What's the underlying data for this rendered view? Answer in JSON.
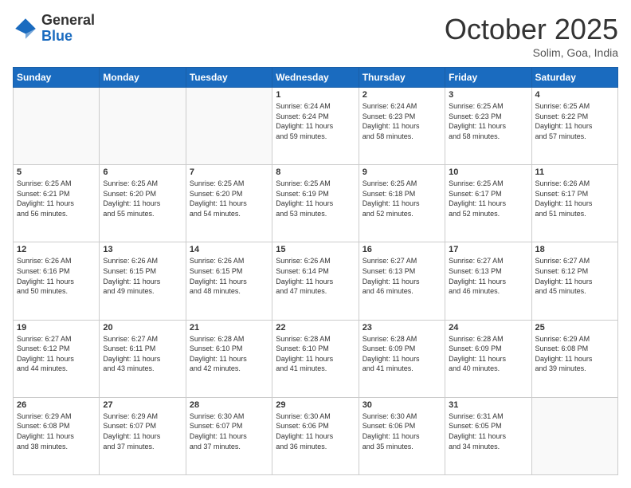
{
  "logo": {
    "general": "General",
    "blue": "Blue"
  },
  "header": {
    "month": "October 2025",
    "location": "Solim, Goa, India"
  },
  "days_of_week": [
    "Sunday",
    "Monday",
    "Tuesday",
    "Wednesday",
    "Thursday",
    "Friday",
    "Saturday"
  ],
  "weeks": [
    [
      {
        "day": "",
        "info": ""
      },
      {
        "day": "",
        "info": ""
      },
      {
        "day": "",
        "info": ""
      },
      {
        "day": "1",
        "info": "Sunrise: 6:24 AM\nSunset: 6:24 PM\nDaylight: 11 hours\nand 59 minutes."
      },
      {
        "day": "2",
        "info": "Sunrise: 6:24 AM\nSunset: 6:23 PM\nDaylight: 11 hours\nand 58 minutes."
      },
      {
        "day": "3",
        "info": "Sunrise: 6:25 AM\nSunset: 6:23 PM\nDaylight: 11 hours\nand 58 minutes."
      },
      {
        "day": "4",
        "info": "Sunrise: 6:25 AM\nSunset: 6:22 PM\nDaylight: 11 hours\nand 57 minutes."
      }
    ],
    [
      {
        "day": "5",
        "info": "Sunrise: 6:25 AM\nSunset: 6:21 PM\nDaylight: 11 hours\nand 56 minutes."
      },
      {
        "day": "6",
        "info": "Sunrise: 6:25 AM\nSunset: 6:20 PM\nDaylight: 11 hours\nand 55 minutes."
      },
      {
        "day": "7",
        "info": "Sunrise: 6:25 AM\nSunset: 6:20 PM\nDaylight: 11 hours\nand 54 minutes."
      },
      {
        "day": "8",
        "info": "Sunrise: 6:25 AM\nSunset: 6:19 PM\nDaylight: 11 hours\nand 53 minutes."
      },
      {
        "day": "9",
        "info": "Sunrise: 6:25 AM\nSunset: 6:18 PM\nDaylight: 11 hours\nand 52 minutes."
      },
      {
        "day": "10",
        "info": "Sunrise: 6:25 AM\nSunset: 6:17 PM\nDaylight: 11 hours\nand 52 minutes."
      },
      {
        "day": "11",
        "info": "Sunrise: 6:26 AM\nSunset: 6:17 PM\nDaylight: 11 hours\nand 51 minutes."
      }
    ],
    [
      {
        "day": "12",
        "info": "Sunrise: 6:26 AM\nSunset: 6:16 PM\nDaylight: 11 hours\nand 50 minutes."
      },
      {
        "day": "13",
        "info": "Sunrise: 6:26 AM\nSunset: 6:15 PM\nDaylight: 11 hours\nand 49 minutes."
      },
      {
        "day": "14",
        "info": "Sunrise: 6:26 AM\nSunset: 6:15 PM\nDaylight: 11 hours\nand 48 minutes."
      },
      {
        "day": "15",
        "info": "Sunrise: 6:26 AM\nSunset: 6:14 PM\nDaylight: 11 hours\nand 47 minutes."
      },
      {
        "day": "16",
        "info": "Sunrise: 6:27 AM\nSunset: 6:13 PM\nDaylight: 11 hours\nand 46 minutes."
      },
      {
        "day": "17",
        "info": "Sunrise: 6:27 AM\nSunset: 6:13 PM\nDaylight: 11 hours\nand 46 minutes."
      },
      {
        "day": "18",
        "info": "Sunrise: 6:27 AM\nSunset: 6:12 PM\nDaylight: 11 hours\nand 45 minutes."
      }
    ],
    [
      {
        "day": "19",
        "info": "Sunrise: 6:27 AM\nSunset: 6:12 PM\nDaylight: 11 hours\nand 44 minutes."
      },
      {
        "day": "20",
        "info": "Sunrise: 6:27 AM\nSunset: 6:11 PM\nDaylight: 11 hours\nand 43 minutes."
      },
      {
        "day": "21",
        "info": "Sunrise: 6:28 AM\nSunset: 6:10 PM\nDaylight: 11 hours\nand 42 minutes."
      },
      {
        "day": "22",
        "info": "Sunrise: 6:28 AM\nSunset: 6:10 PM\nDaylight: 11 hours\nand 41 minutes."
      },
      {
        "day": "23",
        "info": "Sunrise: 6:28 AM\nSunset: 6:09 PM\nDaylight: 11 hours\nand 41 minutes."
      },
      {
        "day": "24",
        "info": "Sunrise: 6:28 AM\nSunset: 6:09 PM\nDaylight: 11 hours\nand 40 minutes."
      },
      {
        "day": "25",
        "info": "Sunrise: 6:29 AM\nSunset: 6:08 PM\nDaylight: 11 hours\nand 39 minutes."
      }
    ],
    [
      {
        "day": "26",
        "info": "Sunrise: 6:29 AM\nSunset: 6:08 PM\nDaylight: 11 hours\nand 38 minutes."
      },
      {
        "day": "27",
        "info": "Sunrise: 6:29 AM\nSunset: 6:07 PM\nDaylight: 11 hours\nand 37 minutes."
      },
      {
        "day": "28",
        "info": "Sunrise: 6:30 AM\nSunset: 6:07 PM\nDaylight: 11 hours\nand 37 minutes."
      },
      {
        "day": "29",
        "info": "Sunrise: 6:30 AM\nSunset: 6:06 PM\nDaylight: 11 hours\nand 36 minutes."
      },
      {
        "day": "30",
        "info": "Sunrise: 6:30 AM\nSunset: 6:06 PM\nDaylight: 11 hours\nand 35 minutes."
      },
      {
        "day": "31",
        "info": "Sunrise: 6:31 AM\nSunset: 6:05 PM\nDaylight: 11 hours\nand 34 minutes."
      },
      {
        "day": "",
        "info": ""
      }
    ]
  ]
}
